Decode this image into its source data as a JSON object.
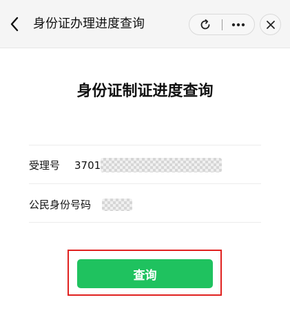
{
  "nav": {
    "title": "身份证办理进度查询",
    "back_icon": "chevron-left-icon",
    "refresh_icon": "refresh-icon",
    "more_icon": "more-dots-icon",
    "close_icon": "close-icon"
  },
  "page": {
    "title": "身份证制证进度查询"
  },
  "form": {
    "acceptance_no": {
      "label": "受理号",
      "value": "3701"
    },
    "id_number": {
      "label": "公民身份号码",
      "value": ""
    }
  },
  "query_button": {
    "label": "查询"
  },
  "colors": {
    "primary_green": "#1fc25f",
    "highlight_red": "#e0201e",
    "nav_bg": "#f5f5f5"
  }
}
